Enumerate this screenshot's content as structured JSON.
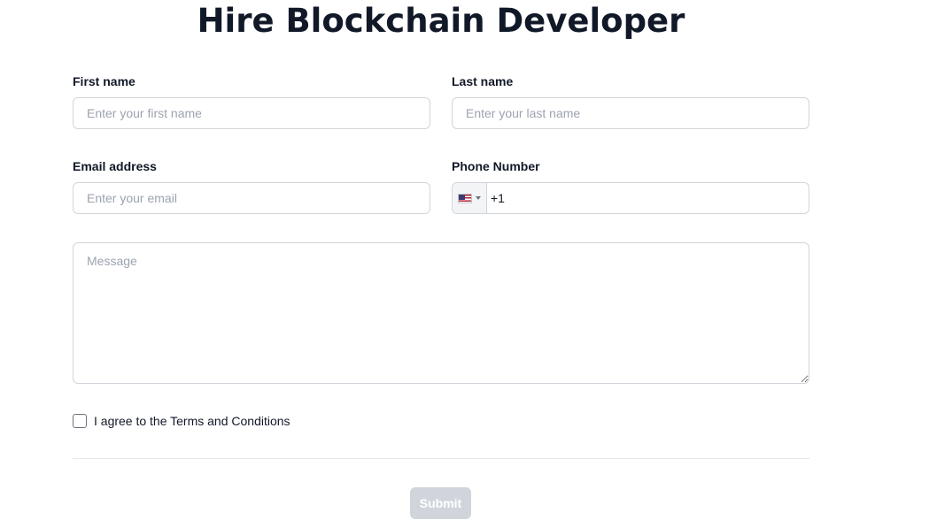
{
  "page": {
    "title": "Hire Blockchain Developer"
  },
  "form": {
    "first_name": {
      "label": "First name",
      "placeholder": "Enter your first name",
      "value": ""
    },
    "last_name": {
      "label": "Last name",
      "placeholder": "Enter your last name",
      "value": ""
    },
    "email": {
      "label": "Email address",
      "placeholder": "Enter your email",
      "value": ""
    },
    "phone": {
      "label": "Phone Number",
      "country_flag": "us-flag-icon",
      "value": "+1"
    },
    "message": {
      "placeholder": "Message",
      "value": ""
    },
    "terms": {
      "label": "I agree to the Terms and Conditions",
      "checked": false
    },
    "submit": {
      "label": "Submit",
      "disabled": true
    }
  },
  "colors": {
    "title": "#111827",
    "border": "#d1d5db",
    "placeholder": "#9ca3af",
    "submit_disabled_bg": "#d1d5db",
    "divider": "#e5e7eb"
  }
}
